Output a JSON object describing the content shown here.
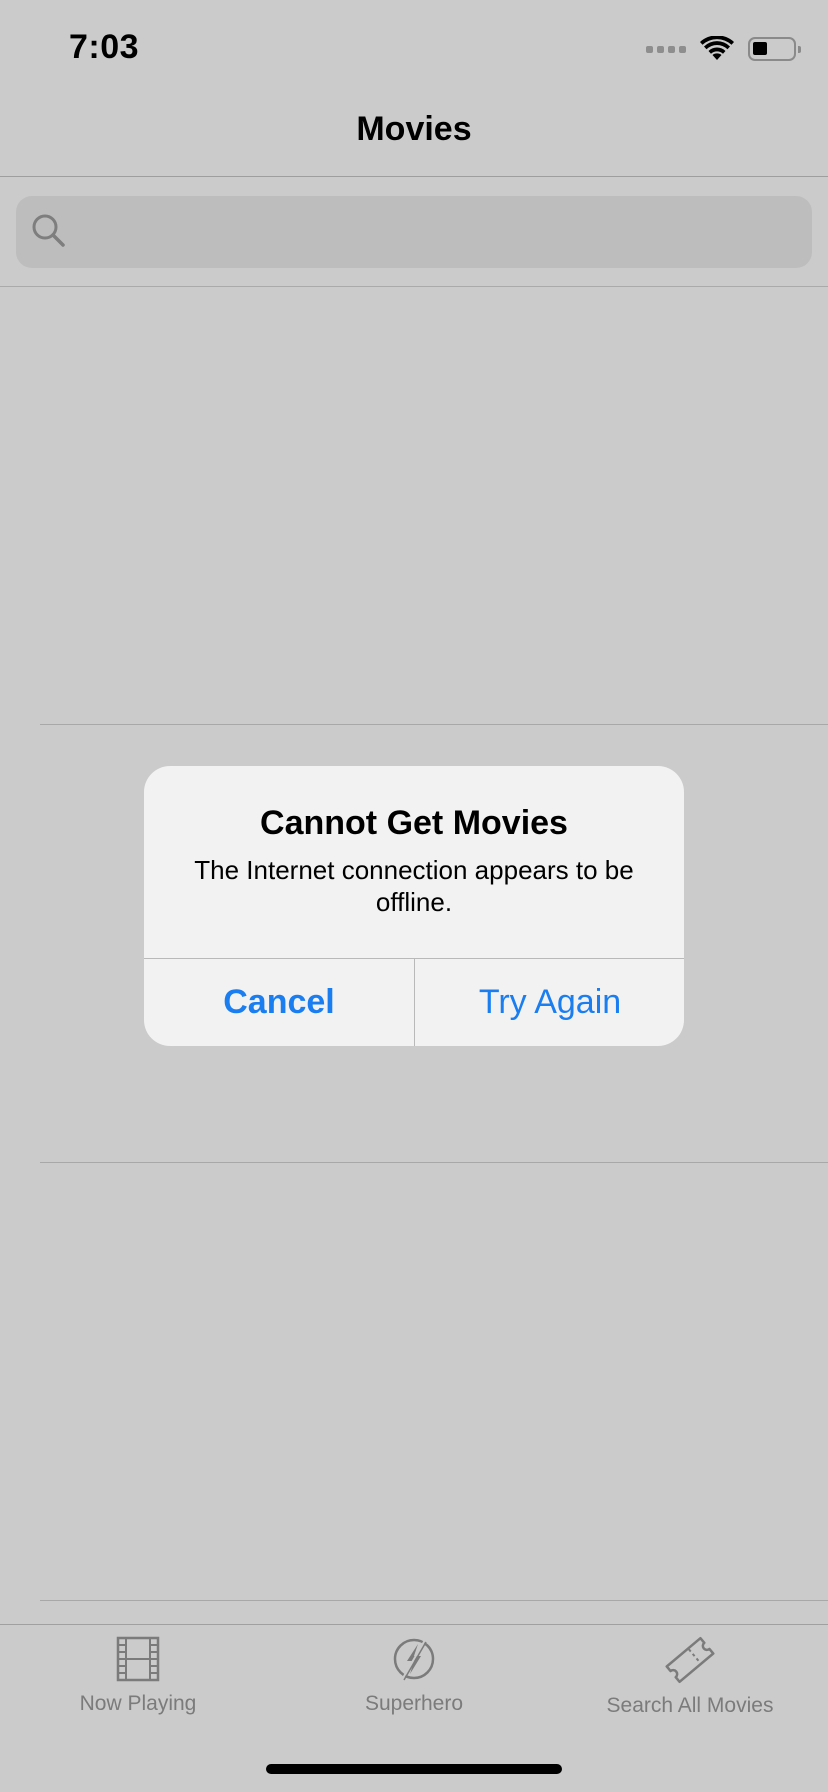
{
  "status_bar": {
    "time": "7:03"
  },
  "nav": {
    "title": "Movies"
  },
  "search": {
    "placeholder": "",
    "value": ""
  },
  "alert": {
    "title": "Cannot Get Movies",
    "message": "The Internet connection appears to be offline.",
    "buttons": {
      "cancel": "Cancel",
      "retry": "Try Again"
    },
    "button_color": "#1a7ef0"
  },
  "tab_bar": {
    "items": [
      {
        "label": "Now Playing",
        "icon": "film-icon"
      },
      {
        "label": "Superhero",
        "icon": "lightning-icon"
      },
      {
        "label": "Search All Movies",
        "icon": "ticket-icon"
      }
    ]
  }
}
